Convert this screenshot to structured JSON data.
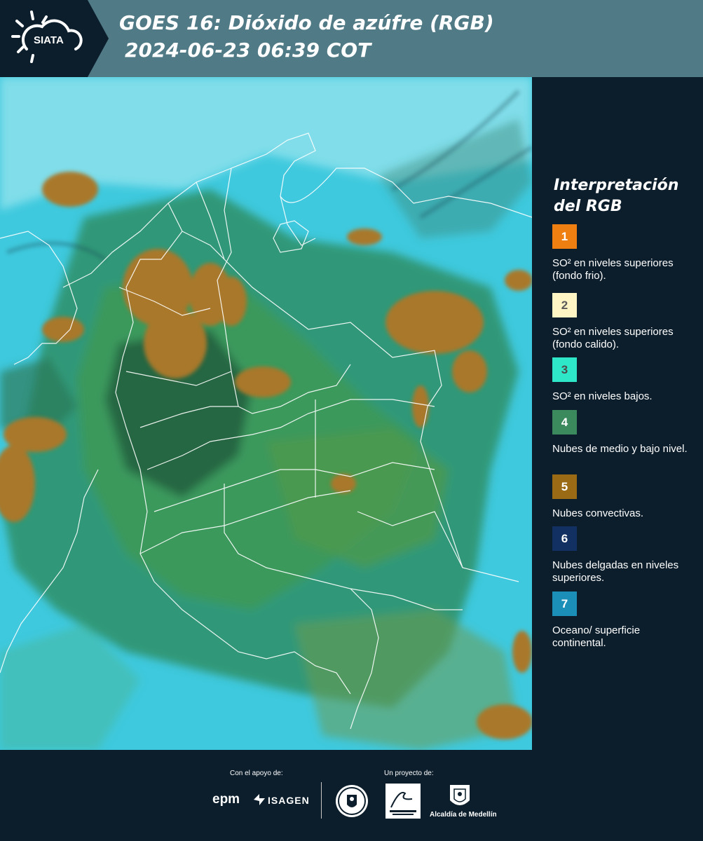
{
  "header": {
    "logo_text": "SIATA",
    "title_line1": "GOES 16: Dióxido de azúfre (RGB)",
    "title_line2": "2024-06-23 06:39 COT",
    "background_color": "#4f7a86"
  },
  "legend": {
    "title": "Interpretación del RGB",
    "items": [
      {
        "number": "1",
        "label": "SO² en niveles superiores (fondo frio).",
        "color": "#f07f12",
        "text_color": "#ffffff"
      },
      {
        "number": "2",
        "label": "SO² en niveles superiores (fondo calido).",
        "color": "#fff4c4",
        "text_color": "#5a5a5a"
      },
      {
        "number": "3",
        "label": "SO² en niveles bajos.",
        "color": "#2ee6c8",
        "text_color": "#4a4a4a"
      },
      {
        "number": "4",
        "label": "Nubes de medio y bajo nivel.",
        "color": "#3b8a5e",
        "text_color": "#ffffff"
      },
      {
        "number": "5",
        "label": "Nubes convectivas.",
        "color": "#9a6a14",
        "text_color": "#ffffff"
      },
      {
        "number": "6",
        "label": "Nubes delgadas en niveles superiores.",
        "color": "#123062",
        "text_color": "#ffffff"
      },
      {
        "number": "7",
        "label": "Oceano/ superficie continental.",
        "color": "#1c8fb8",
        "text_color": "#ffffff"
      }
    ]
  },
  "footer": {
    "support_label": "Con el apoyo de:",
    "project_label": "Un proyecto de:",
    "support_logos": [
      "epm",
      "ISAGEN"
    ],
    "project_logos": [
      "Universidad de Medellín seal",
      "Área Metropolitana Valle de Aburrá",
      "Alcaldía de Medellín"
    ],
    "alcaldia_text": "Alcaldía de Medellín"
  },
  "map": {
    "colors": {
      "background": "#3fc9de",
      "low_clouds": "#3a9a6a",
      "dark_green": "#2f6f4a",
      "convective": "#a9782a",
      "borders": "#ffffff"
    }
  }
}
